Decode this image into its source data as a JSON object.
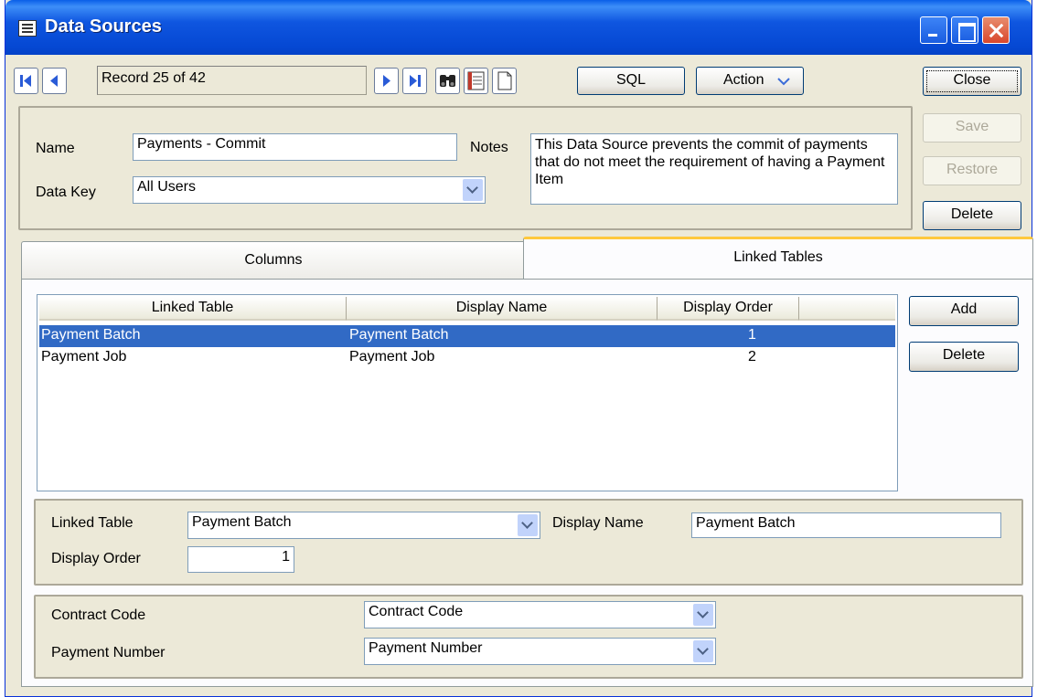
{
  "window": {
    "title": "Data Sources"
  },
  "toolbar": {
    "record_text": "Record 25 of 42",
    "sql_label": "SQL",
    "action_label": "Action",
    "close_label": "Close",
    "save_label": "Save",
    "restore_label": "Restore",
    "delete_label": "Delete"
  },
  "form": {
    "name_label": "Name",
    "name_value": "Payments - Commit",
    "datakey_label": "Data Key",
    "datakey_value": "All Users",
    "notes_label": "Notes",
    "notes_value": "This Data Source prevents the commit of payments that do not meet the requirement of having a Payment Item"
  },
  "tabs": [
    {
      "label": "Columns",
      "active": false
    },
    {
      "label": "Linked Tables",
      "active": true
    }
  ],
  "linked_tables": {
    "columns": [
      "Linked Table",
      "Display Name",
      "Display Order"
    ],
    "rows": [
      {
        "linked_table": "Payment Batch",
        "display_name": "Payment Batch",
        "display_order": "1",
        "selected": true
      },
      {
        "linked_table": "Payment Job",
        "display_name": "Payment Job",
        "display_order": "2",
        "selected": false
      }
    ],
    "add_label": "Add",
    "delete_label": "Delete"
  },
  "detail": {
    "linked_table_label": "Linked Table",
    "linked_table_value": "Payment Batch",
    "display_name_label": "Display Name",
    "display_name_value": "Payment Batch",
    "display_order_label": "Display Order",
    "display_order_value": "1"
  },
  "mapping": {
    "rows": [
      {
        "label": "Contract Code",
        "value": "Contract Code"
      },
      {
        "label": "Payment Number",
        "value": "Payment Number"
      }
    ]
  },
  "colors": {
    "selection": "#316AC5",
    "tab_highlight": "#FFC83C",
    "titlebar": "#0548D3"
  }
}
